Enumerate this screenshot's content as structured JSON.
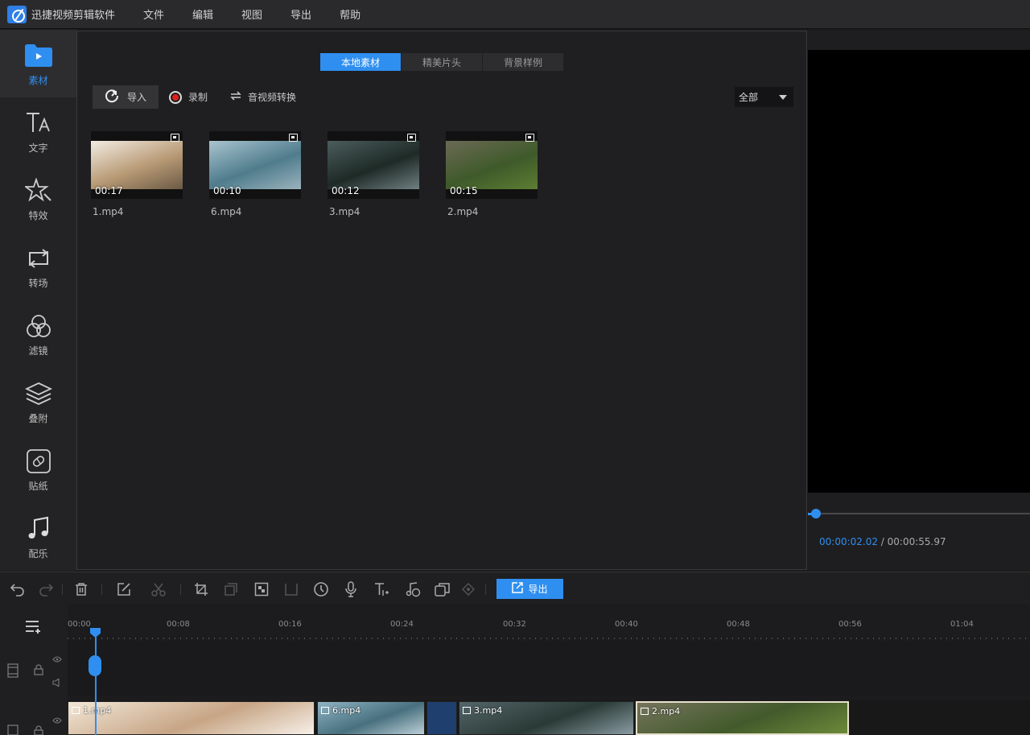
{
  "app": {
    "title": "迅捷视频剪辑软件",
    "menu": [
      "文件",
      "编辑",
      "视图",
      "导出",
      "帮助"
    ],
    "accent_color": "#2f8ff0"
  },
  "sidebar": {
    "items": [
      {
        "label": "素材",
        "icon": "folder-play-icon",
        "active": true
      },
      {
        "label": "文字",
        "icon": "text-icon",
        "active": false
      },
      {
        "label": "特效",
        "icon": "star-effect-icon",
        "active": false
      },
      {
        "label": "转场",
        "icon": "transition-icon",
        "active": false
      },
      {
        "label": "滤镜",
        "icon": "filter-icon",
        "active": false
      },
      {
        "label": "叠附",
        "icon": "layers-icon",
        "active": false
      },
      {
        "label": "贴纸",
        "icon": "sticker-icon",
        "active": false
      },
      {
        "label": "配乐",
        "icon": "music-note-icon",
        "active": false
      }
    ]
  },
  "media": {
    "tabs": [
      {
        "label": "本地素材",
        "active": true
      },
      {
        "label": "精美片头",
        "active": false
      },
      {
        "label": "背景样例",
        "active": false
      }
    ],
    "toolbar": {
      "import_label": "导入",
      "record_label": "录制",
      "convert_label": "音视频转换"
    },
    "filter": {
      "selected": "全部"
    },
    "files": [
      {
        "name": "1.mp4",
        "duration": "00:17",
        "colors": [
          "#f3ece2",
          "#b89a75",
          "#6b5a45"
        ]
      },
      {
        "name": "6.mp4",
        "duration": "00:10",
        "colors": [
          "#a9c4cf",
          "#4f7c8c",
          "#9bb3bd"
        ]
      },
      {
        "name": "3.mp4",
        "duration": "00:12",
        "colors": [
          "#4b5d5c",
          "#1e2a26",
          "#707f82"
        ]
      },
      {
        "name": "2.mp4",
        "duration": "00:15",
        "colors": [
          "#6b6a55",
          "#3f5a2a",
          "#5d7d33"
        ]
      }
    ]
  },
  "preview": {
    "current_time": "00:00:02.02",
    "separator": " / ",
    "total_time": "00:00:55.97",
    "progress_fraction": 0.036
  },
  "edit_toolbar": {
    "export_label": "导出",
    "tools": [
      "undo-icon",
      "redo-icon",
      "delete-icon",
      "edit-icon",
      "cut-icon",
      "crop-icon",
      "copy-icon",
      "mosaic-icon",
      "freeze-icon",
      "speed-icon",
      "mic-icon",
      "text-add-icon",
      "audio-separate-icon",
      "picture-icon",
      "keyframe-icon"
    ]
  },
  "timeline": {
    "ticks": [
      "00:00",
      "00:08",
      "00:16",
      "00:24",
      "00:32",
      "00:40",
      "00:48",
      "00:56",
      "01:04"
    ],
    "clips": [
      {
        "name": "1.mp4",
        "colors": [
          "#f2e7d8",
          "#c7a585",
          "#f7f0e8"
        ]
      },
      {
        "name": "6.mp4",
        "colors": [
          "#8fb4c4",
          "#48707e",
          "#bcd0d8"
        ]
      },
      {
        "name": "3.mp4",
        "colors": [
          "#54656a",
          "#2a3a35",
          "#8a9ca4"
        ]
      },
      {
        "name": "2.mp4",
        "colors": [
          "#75745d",
          "#425a2b",
          "#6c8a3a"
        ]
      }
    ]
  }
}
